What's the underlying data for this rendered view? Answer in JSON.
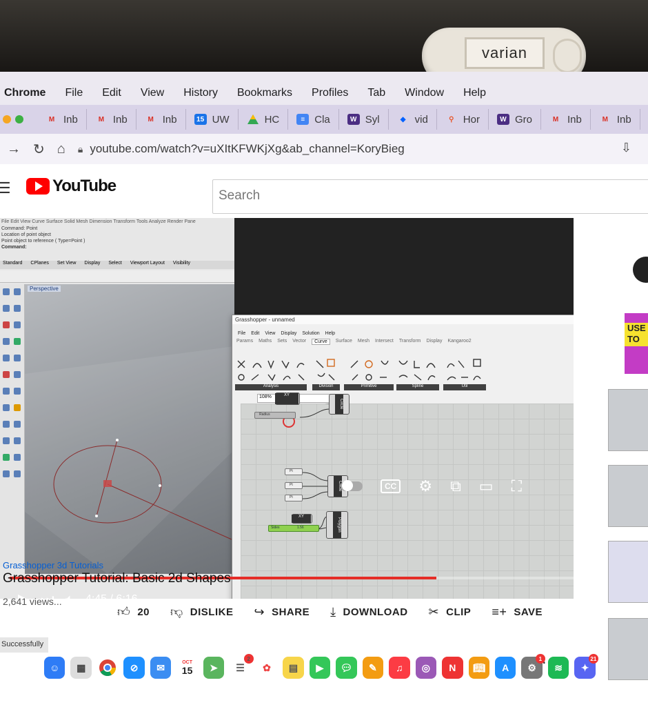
{
  "menubar": {
    "app": "Chrome",
    "items": [
      "File",
      "Edit",
      "View",
      "History",
      "Bookmarks",
      "Profiles",
      "Tab",
      "Window",
      "Help"
    ]
  },
  "webcam_cover": {
    "brand": "varian"
  },
  "tabs": [
    {
      "label": "Inb",
      "icon": "gmail-icon"
    },
    {
      "label": "Inb",
      "icon": "gmail-icon"
    },
    {
      "label": "Inb",
      "icon": "gmail-icon"
    },
    {
      "label": "UW",
      "icon": "calendar-icon",
      "badge": "15"
    },
    {
      "label": "HC",
      "icon": "drive-icon"
    },
    {
      "label": "Cla",
      "icon": "docs-icon"
    },
    {
      "label": "Syl",
      "icon": "uw-icon",
      "badge": "W"
    },
    {
      "label": "vid",
      "icon": "dropbox-icon"
    },
    {
      "label": "Hor",
      "icon": "pin-icon"
    },
    {
      "label": "Gro",
      "icon": "uw-icon",
      "badge": "W"
    },
    {
      "label": "Inb",
      "icon": "gmail-icon"
    },
    {
      "label": "Inb",
      "icon": "gmail-icon"
    }
  ],
  "address": {
    "url": "youtube.com/watch?v=uXItKFWKjXg&ab_channel=KoryBieg"
  },
  "youtube": {
    "logo": "YouTube",
    "search_placeholder": "Search"
  },
  "rhino": {
    "menu": "File  Edit  View  Curve  Surface  Solid  Mesh  Dimension  Transform  Tools  Analyze  Render  Pane",
    "command_lines": [
      "Command: Point",
      "Location of point object",
      "Point object to reference ( Type=Point )",
      "Command:"
    ],
    "tabs": [
      "Standard",
      "CPlanes",
      "Set View",
      "Display",
      "Select",
      "Viewport Layout",
      "Visibility"
    ],
    "viewport": "Perspective"
  },
  "grasshopper": {
    "title": "Grasshopper - unnamed",
    "menu": [
      "File",
      "Edit",
      "View",
      "Display",
      "Solution",
      "Help"
    ],
    "tabs": [
      "Params",
      "Maths",
      "Sets",
      "Vector",
      "Curve",
      "Surface",
      "Mesh",
      "Intersect",
      "Transform",
      "Display",
      "Kangaroo2"
    ],
    "active_tab": "Curve",
    "groups": [
      "Analysis",
      "Division",
      "Primitive",
      "Spline",
      "Util"
    ],
    "zoom": "108%",
    "doc_name": "unnamed",
    "nodes": {
      "xy": "XY",
      "circle1": "Circle",
      "circle2": "Circle",
      "polygon": "Polygon",
      "radius": "Radius",
      "pt": "Pt",
      "slider_label": "Sides",
      "slider_value": "1.56"
    }
  },
  "player": {
    "time": "4:45 / 6:16",
    "progress_fraction": 0.757,
    "cc": "CC"
  },
  "video": {
    "channel": "Grasshopper 3d Tutorials",
    "title": "Grasshopper Tutorial: Basic 2d Shapes",
    "views": "2,641 views..."
  },
  "actions": {
    "like": "20",
    "dislike": "DISLIKE",
    "share": "SHARE",
    "download": "DOWNLOAD",
    "clip": "CLIP",
    "save": "SAVE"
  },
  "sidebar": {
    "promo": "USE\nTO"
  },
  "toast": "Successfully",
  "dock": {
    "calendar_month": "OCT",
    "calendar_day": "15",
    "badges": [
      "2",
      "1",
      "21"
    ]
  },
  "colors": {
    "youtube_red": "#ff0000",
    "progress": "#e52d27",
    "tabstrip": "#d9d3e8",
    "slider_green": "#8fd14f"
  }
}
